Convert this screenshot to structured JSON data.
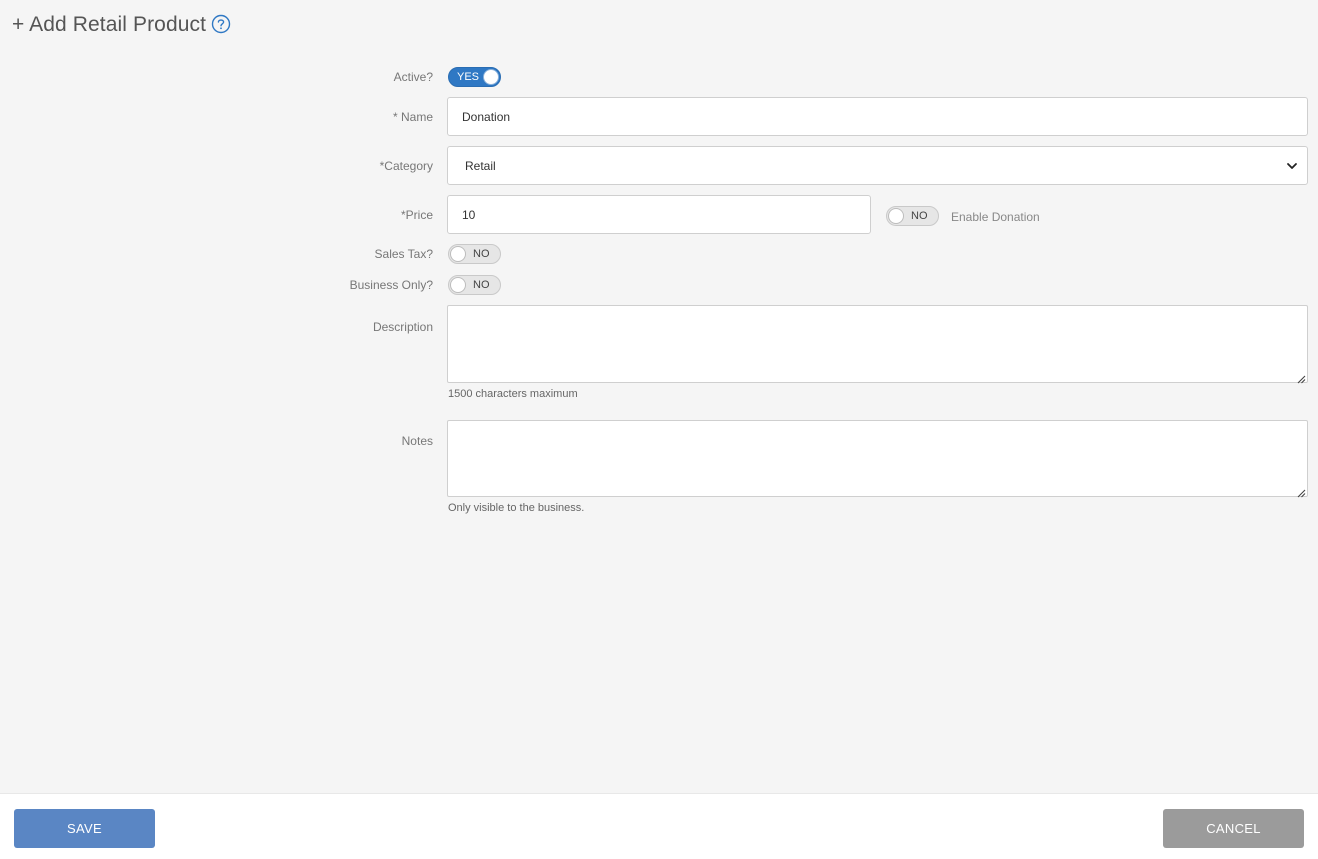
{
  "header": {
    "title": "+ Add Retail Product"
  },
  "form": {
    "active": {
      "label": "Active?",
      "state": "YES"
    },
    "name": {
      "label": "* Name",
      "value": "Donation"
    },
    "category": {
      "label": "*Category",
      "selected": "Retail"
    },
    "price": {
      "label": "*Price",
      "value": "10",
      "donation_toggle": "NO",
      "donation_label": "Enable Donation"
    },
    "sales_tax": {
      "label": "Sales Tax?",
      "state": "NO"
    },
    "business_only": {
      "label": "Business Only?",
      "state": "NO"
    },
    "description": {
      "label": "Description",
      "value": "",
      "hint": "1500 characters maximum"
    },
    "notes": {
      "label": "Notes",
      "value": "",
      "hint": "Only visible to the business."
    }
  },
  "footer": {
    "save_label": "SAVE",
    "cancel_label": "CANCEL"
  },
  "colors": {
    "toggle_on": "#2f78c4",
    "save_button": "#5a86c4",
    "cancel_button": "#9b9b9b",
    "help_icon": "#2f78c4"
  }
}
